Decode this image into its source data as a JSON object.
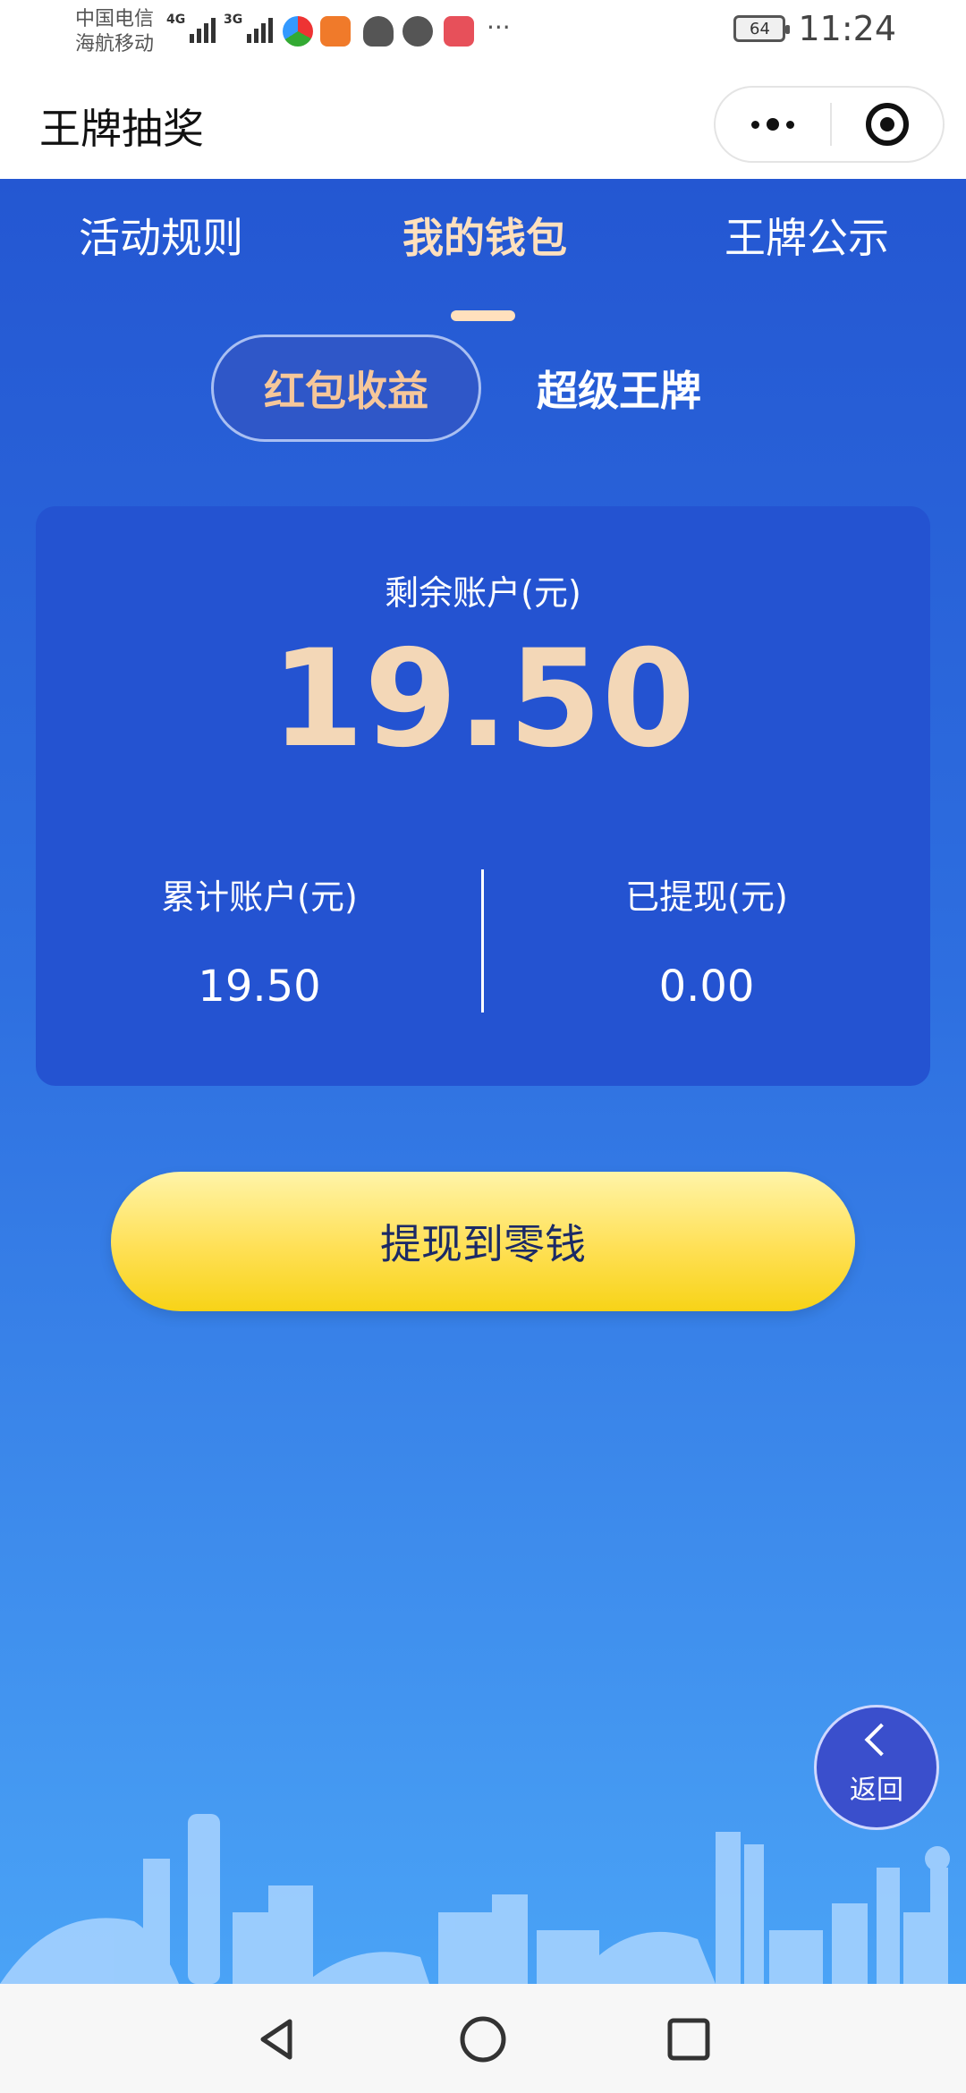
{
  "status_bar": {
    "carrier_1": "中国电信",
    "carrier_2": "海航移动",
    "sig1_label": "4G",
    "sig2_label": "3G",
    "battery": "64",
    "time": "11:24"
  },
  "title_bar": {
    "title": "王牌抽奖",
    "more_icon": "more-dots-icon",
    "close_icon": "target-close-icon"
  },
  "tabs": [
    {
      "label": "活动规则"
    },
    {
      "label": "我的钱包"
    },
    {
      "label": "王牌公示"
    }
  ],
  "subtabs": {
    "active": "红包收益",
    "other": "超级王牌"
  },
  "card": {
    "balance_label": "剩余账户(元)",
    "balance": "19.50",
    "total_label": "累计账户(元)",
    "total": "19.50",
    "withdrawn_label": "已提现(元)",
    "withdrawn": "0.00"
  },
  "withdraw_button": "提现到零钱",
  "back_button": "返回",
  "colors": {
    "accent_gold": "#f3d7b7",
    "button_yellow": "#ffe055",
    "card_blue": "#2453d1"
  }
}
